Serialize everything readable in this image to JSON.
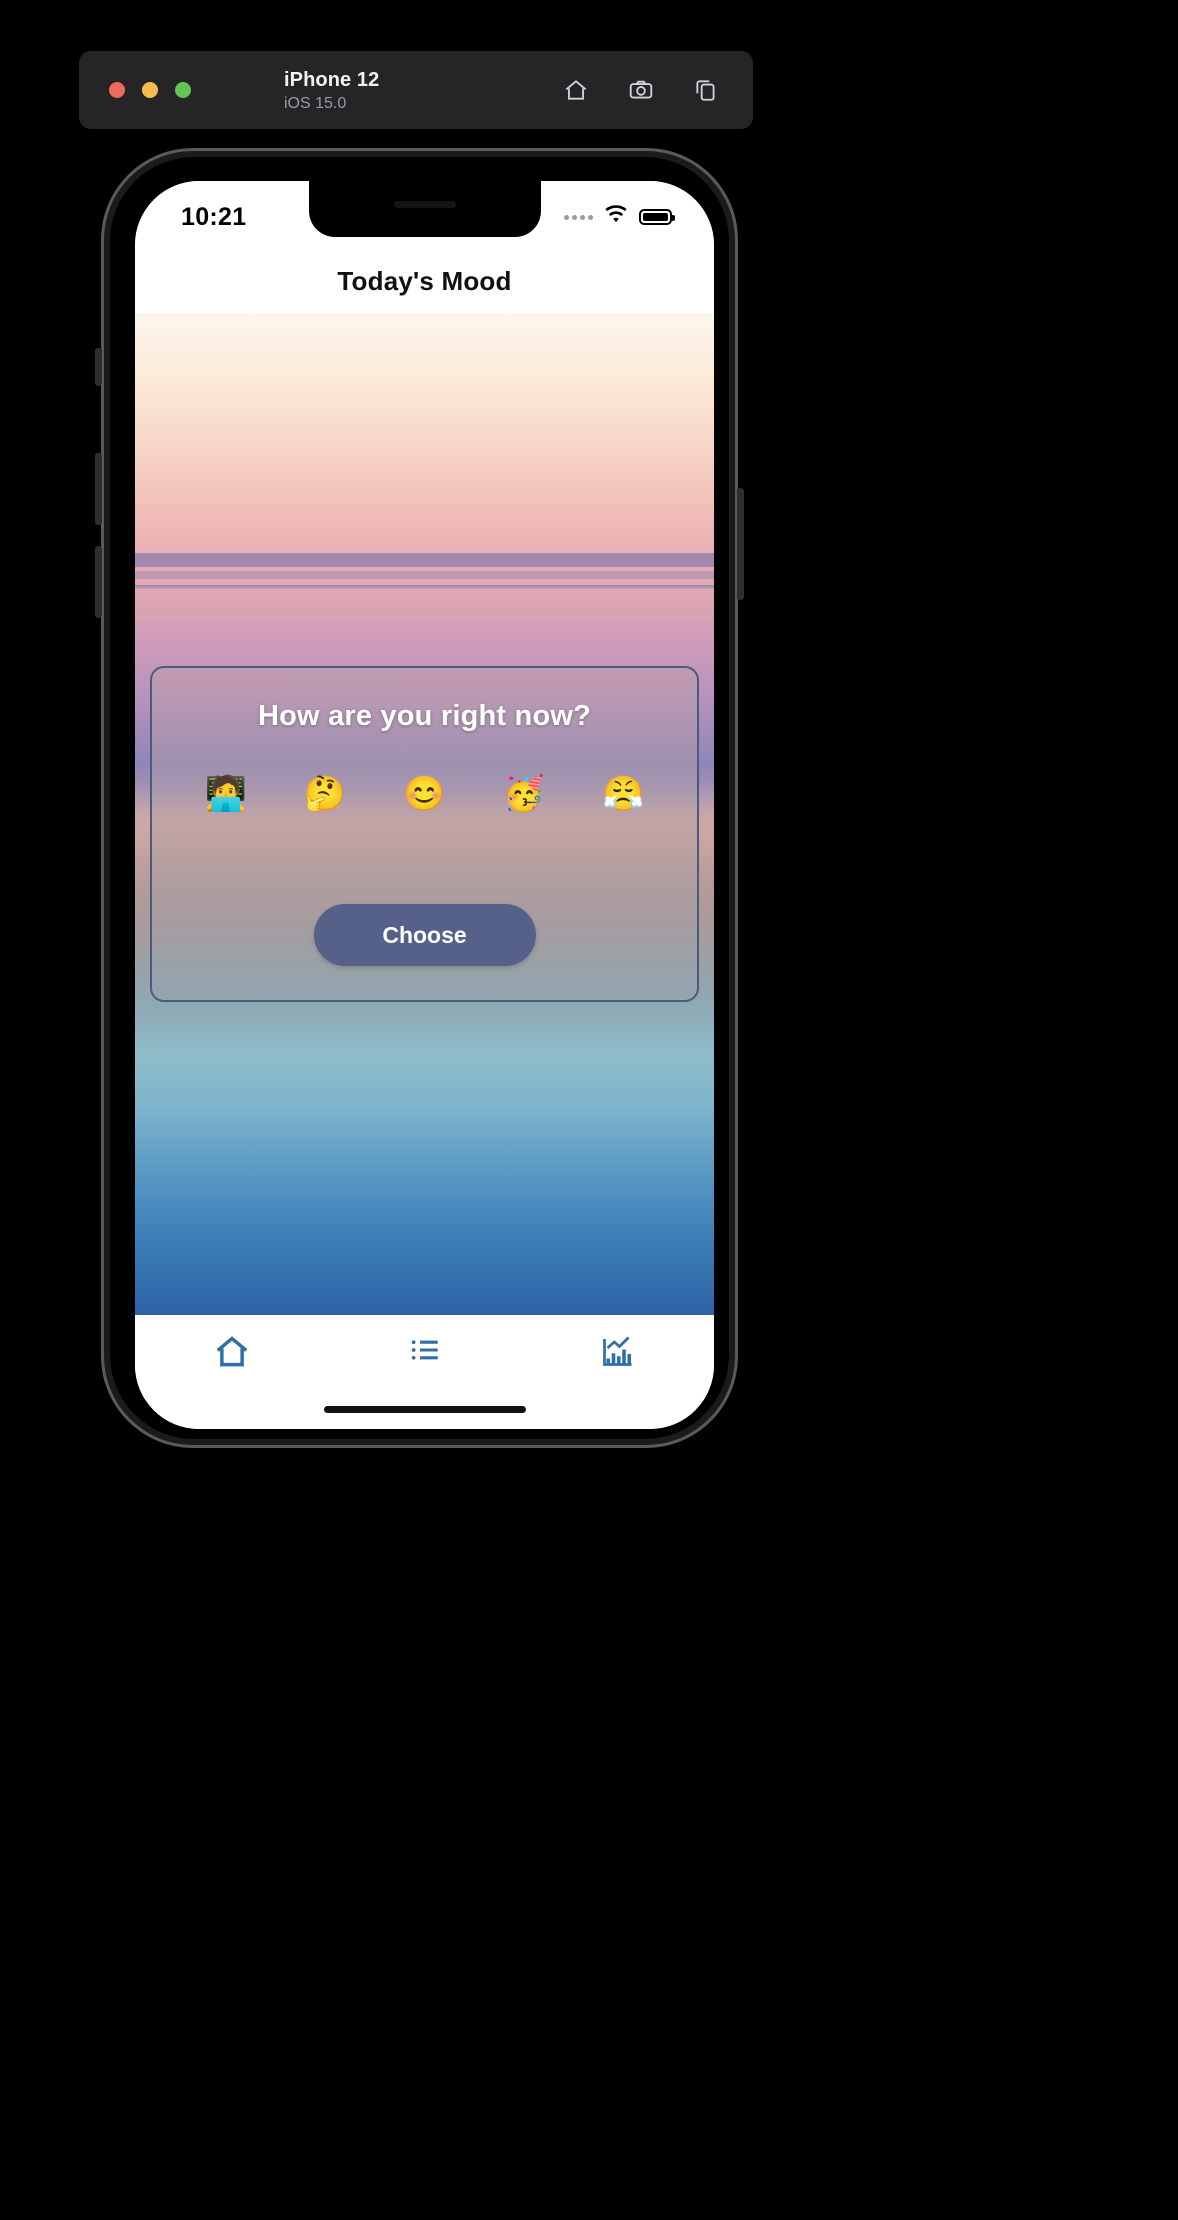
{
  "simulator": {
    "device_name": "iPhone 12",
    "os_version": "iOS 15.0",
    "traffic_lights": [
      {
        "name": "close",
        "color": "#ED6A5E"
      },
      {
        "name": "minimize",
        "color": "#F4BE4F"
      },
      {
        "name": "zoom",
        "color": "#61C454"
      }
    ],
    "toolbar_icons": [
      "home-icon",
      "camera-icon",
      "rotate-icon"
    ]
  },
  "status_bar": {
    "time": "10:21",
    "signal_icon": "signal-dots-icon",
    "wifi_icon": "wifi-icon",
    "battery_icon": "battery-icon",
    "battery_level": 100
  },
  "nav": {
    "title": "Today's Mood"
  },
  "card": {
    "question": "How are you right now?",
    "border_color": "#4c5a7d",
    "moods": [
      {
        "emoji": "🧑‍💻",
        "name": "mood-working"
      },
      {
        "emoji": "🤔",
        "name": "mood-thinking"
      },
      {
        "emoji": "😊",
        "name": "mood-happy"
      },
      {
        "emoji": "🥳",
        "name": "mood-celebrating"
      },
      {
        "emoji": "😤",
        "name": "mood-frustrated"
      }
    ],
    "choose_label": "Choose",
    "choose_color": "#56618a"
  },
  "tabbar": {
    "items": [
      {
        "icon": "home-icon",
        "name": "tab-home"
      },
      {
        "icon": "list-icon",
        "name": "tab-list"
      },
      {
        "icon": "chart-icon",
        "name": "tab-stats"
      }
    ],
    "accent_color": "#2f6fa8"
  }
}
